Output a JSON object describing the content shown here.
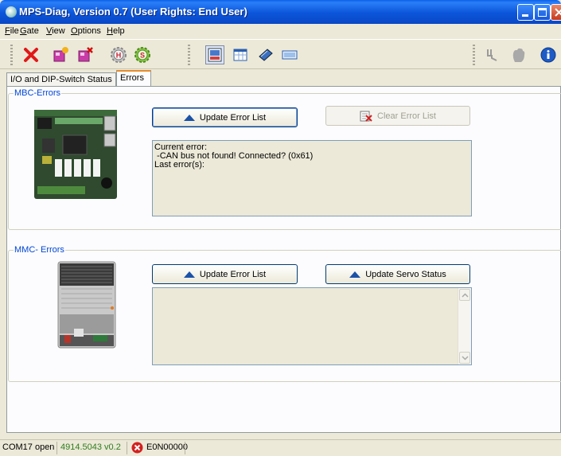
{
  "window": {
    "title": "MPS-Diag, Version 0.7 (User Rights: End User)"
  },
  "menu": {
    "items": [
      {
        "pre": "",
        "u": "F",
        "post": "ile"
      },
      {
        "pre": "",
        "u": "G",
        "post": "ate"
      },
      {
        "pre": "",
        "u": "V",
        "post": "iew"
      },
      {
        "pre": "",
        "u": "O",
        "post": "ptions"
      },
      {
        "pre": "",
        "u": "H",
        "post": "elp"
      }
    ]
  },
  "toolbar": {
    "icons": [
      "delete-icon",
      "add-gate-icon",
      "remove-gate-icon",
      "h-gear-icon",
      "s-gear-icon",
      "diagram-view-icon",
      "table-view-icon",
      "device-icon",
      "display-icon",
      "cable-icon",
      "hand-icon",
      "info-icon"
    ]
  },
  "tabs": [
    {
      "label": "I/O and DIP-Switch Status",
      "active": false
    },
    {
      "label": "Errors",
      "active": true
    }
  ],
  "mbc": {
    "group_label": "MBC-Errors",
    "update_label": "Update Error List",
    "clear_label": "Clear Error List",
    "text_lines": [
      "Current error:",
      " -CAN bus not found! Connected? (0x61)",
      "Last error(s):"
    ]
  },
  "mmc": {
    "group_label": "MMC- Errors",
    "update_label": "Update Error List",
    "servo_label": "Update Servo Status",
    "text_lines": []
  },
  "status": {
    "port": "COM17 open",
    "version": "4914.5043 v0.2",
    "error_code": "E0N00000",
    "version_color": "#2e7d1e",
    "error_color": "#d42020"
  }
}
